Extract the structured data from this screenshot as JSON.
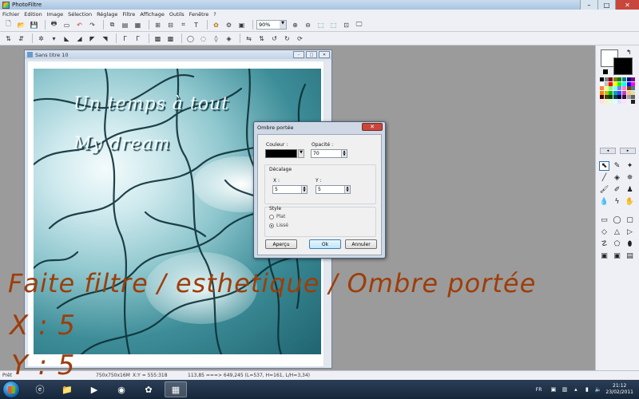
{
  "app": {
    "title": "PhotoFiltre"
  },
  "menu": [
    "Fichier",
    "Edition",
    "Image",
    "Sélection",
    "Réglage",
    "Filtre",
    "Affichage",
    "Outils",
    "Fenêtre",
    "?"
  ],
  "toolbar": {
    "zoom": "90%"
  },
  "document": {
    "title": "Sans titre 10",
    "caption_line1": "Un temps à tout",
    "caption_line2": "My dream"
  },
  "dialog": {
    "title": "Ombre portée",
    "color_label": "Couleur :",
    "opacity_label": "Opacité :",
    "opacity_value": "70",
    "offset_group": "Décalage",
    "x_label": "X :",
    "x_value": "5",
    "y_label": "Y :",
    "y_value": "5",
    "style_group": "Style",
    "style_options": [
      "Plat",
      "Lissé"
    ],
    "selected_style": "Lissé",
    "preview_button": "Aperçu",
    "ok_button": "Ok",
    "cancel_button": "Annuler",
    "shadow_color": "#000000"
  },
  "status": {
    "ready": "Prêt",
    "size": "750x750x16M",
    "coords": "X:Y = 555:318",
    "selection": "113,85 ===> 649,245 (L=537, H=161, L/H=3,34)"
  },
  "overlay": {
    "line1": "Faite filtre  / esthetique / Ombre portée",
    "line2": "X : 5",
    "line3": "Y : 5"
  },
  "taskbar": {
    "lang": "FR",
    "time": "21:12",
    "date": "23/02/2011"
  },
  "colors": {
    "overlay_text": "#9e3d0a",
    "accent": "#3c7fb1"
  }
}
